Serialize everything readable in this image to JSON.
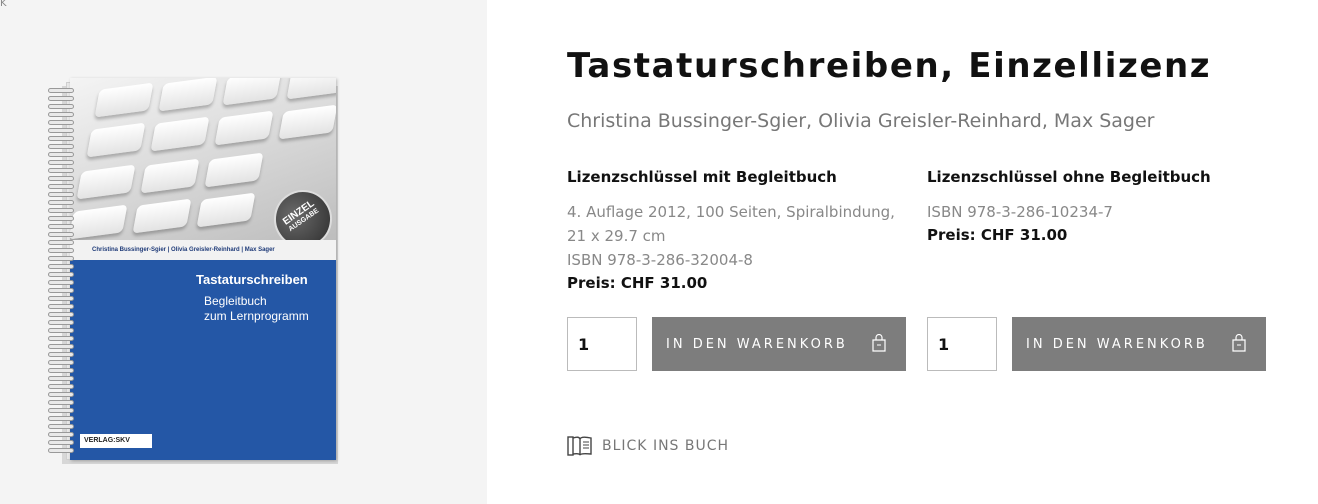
{
  "page": {
    "corner_mark": "K"
  },
  "cover": {
    "authors_line": "Christina Bussinger-Sgier | Olivia Greisler-Reinhard | Max Sager",
    "title": "Tastaturschreiben",
    "subtitle_1": "Begleitbuch",
    "subtitle_2": "zum Lernprogramm",
    "badge_line_1": "EINZEL",
    "badge_line_2": "AUSGABE",
    "publisher": "VERLAG:SKV"
  },
  "product": {
    "title": "Tastaturschreiben, Einzellizenz",
    "authors": "Christina Bussinger-Sgier, Olivia Greisler-Reinhard, Max Sager"
  },
  "options": [
    {
      "heading": "Lizenzschlüssel mit Begleitbuch",
      "details_1": "4. Auflage 2012, 100 Seiten, Spiralbindung, 21 x 29.7 cm",
      "details_2": "ISBN 978-3-286-32004-8",
      "price": "Preis: CHF 31.00",
      "quantity": "1",
      "cart_label": "IN DEN WARENKORB"
    },
    {
      "heading": "Lizenzschlüssel ohne Begleitbuch",
      "details_1": "ISBN 978-3-286-10234-7",
      "price": "Preis: CHF 31.00",
      "quantity": "1",
      "cart_label": "IN DEN WARENKORB"
    }
  ],
  "preview": {
    "label": "BLICK INS BUCH",
    "icon": "open-book-icon"
  },
  "colors": {
    "cover_blue": "#2457a6",
    "button_gray": "#7d7d7d",
    "left_panel_bg": "#f4f4f4"
  }
}
